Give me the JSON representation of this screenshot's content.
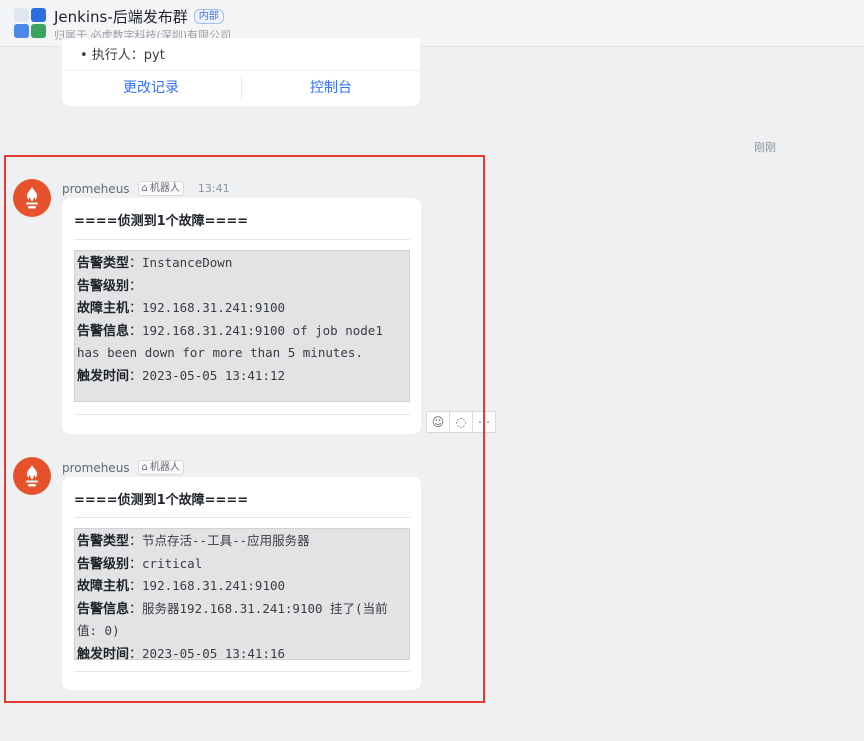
{
  "header": {
    "group_name": "Jenkins-后端发布群",
    "badge": "内部",
    "owner": "归属于 必虎数字科技(深圳)有限公司"
  },
  "top_card": {
    "bullet": "• 执行人：pyt",
    "btn_left": "更改记录",
    "btn_right": "控制台"
  },
  "right_time": "刚刚",
  "messages": [
    {
      "sender": "promeheus",
      "bot_tag": "机器人",
      "time": "13:41",
      "heading": "====侦测到1个故障====",
      "lines": [
        {
          "k": "告警类型",
          "sep": "：",
          "v": "InstanceDown"
        },
        {
          "k": "告警级别",
          "sep": "：",
          "v": ""
        },
        {
          "k": "故障主机",
          "sep": "：",
          "v": "192.168.31.241:9100"
        },
        {
          "k": "告警信息",
          "sep": "：",
          "v": "192.168.31.241:9100 of job node1 has been down for more than 5 minutes."
        },
        {
          "k": "触发时间",
          "sep": "：",
          "v": "2023-05-05 13:41:12"
        }
      ]
    },
    {
      "sender": "promeheus",
      "bot_tag": "机器人",
      "time": "",
      "heading": "====侦测到1个故障====",
      "lines": [
        {
          "k": "告警类型",
          "sep": "：",
          "v": "节点存活--工具--应用服务器"
        },
        {
          "k": "告警级别",
          "sep": "：",
          "v": "critical"
        },
        {
          "k": "故障主机",
          "sep": "：",
          "v": "192.168.31.241:9100"
        },
        {
          "k": "告警信息",
          "sep": "：",
          "v": "服务器192.168.31.241:9100 挂了(当前值: 0)"
        },
        {
          "k": "触发时间",
          "sep": "：",
          "v": "2023-05-05 13:41:16"
        }
      ]
    }
  ],
  "actions": [
    "emoji-add-icon",
    "comment-icon",
    "more-icon"
  ]
}
